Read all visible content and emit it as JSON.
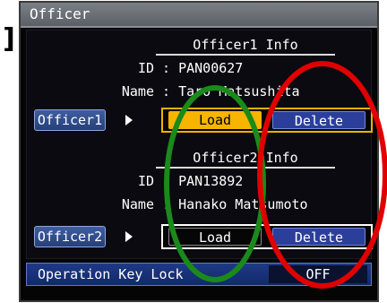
{
  "window": {
    "title": "Officer"
  },
  "officer1": {
    "section_title": "Officer1 Info",
    "id_label": "ID",
    "id_value": "PAN00627",
    "name_label": "Name",
    "name_value": "Taro Matsushita",
    "select_label": "Officer1",
    "load_label": "Load",
    "delete_label": "Delete"
  },
  "officer2": {
    "section_title": "Officer2 Info",
    "id_label": "ID",
    "id_value": "PAN13892",
    "name_label": "Name",
    "name_value": "Hanako Matsumoto",
    "select_label": "Officer2",
    "load_label": "Load",
    "delete_label": "Delete"
  },
  "operation_lock": {
    "label": "Operation Key Lock",
    "value": "OFF"
  },
  "colors": {
    "focus_accent": "#f7b400",
    "button_blue": "#2b3f9a",
    "annotation_green": "#1a8a1a",
    "annotation_red": "#e00000"
  },
  "page_marker": "]"
}
